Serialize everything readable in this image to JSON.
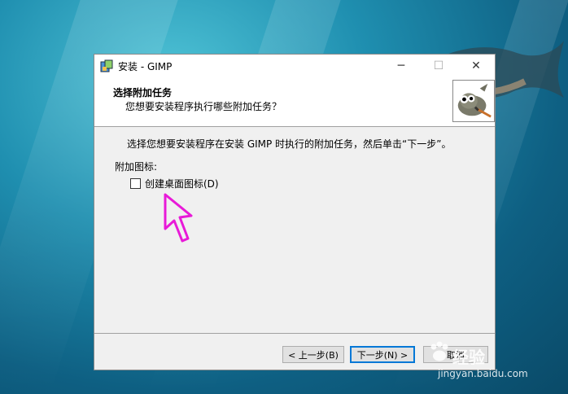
{
  "window": {
    "title": "安装 - GIMP",
    "controls": {
      "minimize": "─",
      "maximize": "☐",
      "close": "✕"
    }
  },
  "header": {
    "title": "选择附加任务",
    "subtitle": "您想要安装程序执行哪些附加任务？"
  },
  "body": {
    "instruction": "选择您想要安装程序在安装 GIMP 时执行的附加任务，然后单击“下一步”。",
    "additional_icons_label": "附加图标:",
    "checkbox": {
      "label": "创建桌面图标(D)",
      "checked": false
    }
  },
  "buttons": {
    "back": "< 上一步(B)",
    "next": "下一步(N) >",
    "cancel": "取消"
  },
  "watermark": {
    "text": "经验",
    "url": "jingyan.baidu.com"
  },
  "colors": {
    "accent": "#0078d7",
    "cursor": "#e81ad8",
    "dialog_bg": "#f0f0f0"
  }
}
